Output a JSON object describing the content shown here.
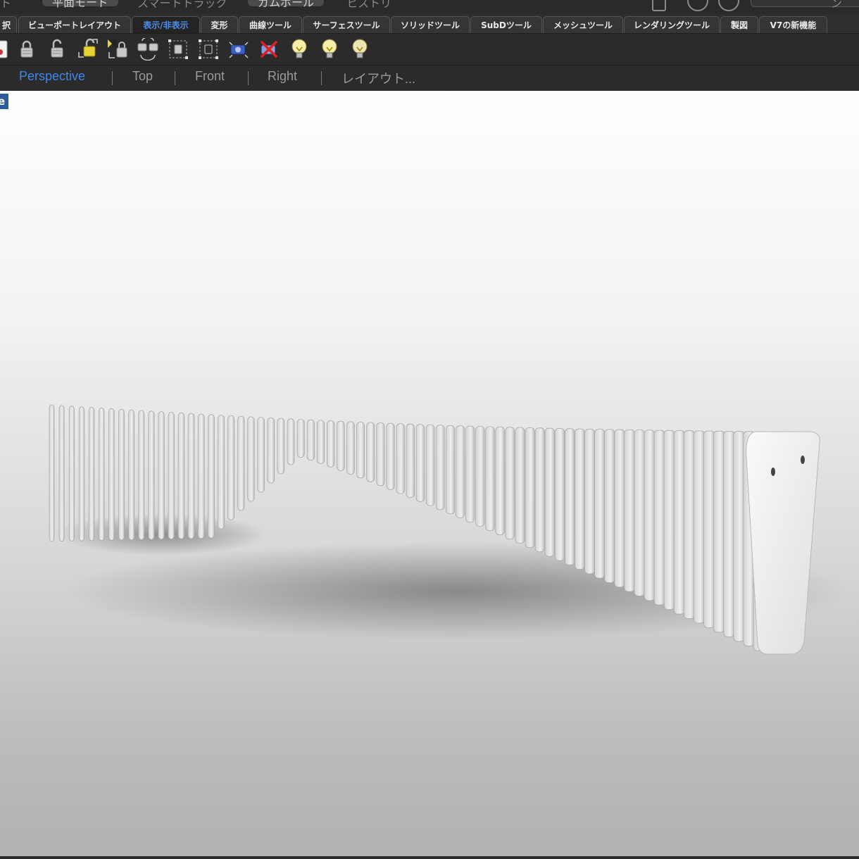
{
  "top_strip": {
    "items": [
      "ト",
      "平面モード",
      "スマートトラック",
      "ガムボール",
      "ヒストリ"
    ],
    "right_text": "ン"
  },
  "ribbon_tabs": [
    {
      "label": "択",
      "active": false
    },
    {
      "label": "ビューポートレイアウト",
      "active": false
    },
    {
      "label": "表示/非表示",
      "active": true
    },
    {
      "label": "変形",
      "active": false
    },
    {
      "label": "曲線ツール",
      "active": false
    },
    {
      "label": "サーフェスツール",
      "active": false
    },
    {
      "label": "ソリッドツール",
      "active": false
    },
    {
      "label": "SubDツール",
      "active": false
    },
    {
      "label": "メッシュツール",
      "active": false
    },
    {
      "label": "レンダリングツール",
      "active": false
    },
    {
      "label": "製図",
      "active": false
    },
    {
      "label": "V7の新機能",
      "active": false
    }
  ],
  "toolbar_icons": [
    "document-icon",
    "lock-icon",
    "unlock-icon",
    "unlock-selected-icon",
    "lock-swap-icon",
    "lock-swap-arrows-icon",
    "select-box-icon",
    "select-box-dashed-icon",
    "show-camera-icon",
    "hide-camera-icon",
    "light-on-icon",
    "light-on-2-icon",
    "light-off-icon"
  ],
  "viewport_tabs": [
    {
      "label": "Perspective",
      "active": true
    },
    {
      "label": "Top",
      "active": false
    },
    {
      "label": "Front",
      "active": false
    },
    {
      "label": "Right",
      "active": false
    },
    {
      "label": "レイアウト...",
      "active": false
    }
  ],
  "viewport": {
    "label": "e",
    "accent": "#3f86ea"
  }
}
